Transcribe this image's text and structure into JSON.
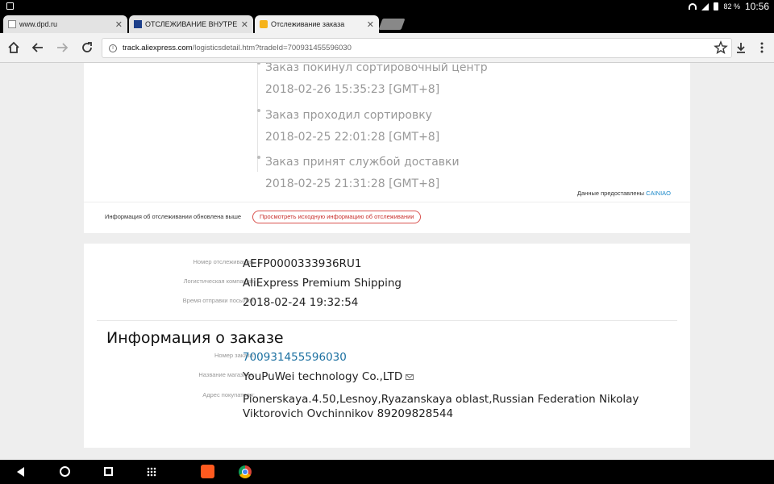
{
  "status_bar": {
    "battery": "82 %",
    "time": "10:56"
  },
  "tabs": [
    {
      "label": "www.dpd.ru",
      "favicon": "page-icon"
    },
    {
      "label": "ОТСЛЕЖИВАНИЕ ВНУТРЕННЕГО",
      "favicon": "tracking-17-icon"
    },
    {
      "label": "Отслеживание заказа",
      "favicon": "aliexpress-icon",
      "active": true
    }
  ],
  "toolbar": {
    "url_host": "track.aliexpress.com",
    "url_path": "/logisticsdetail.htm?tradeId=700931455596030"
  },
  "timeline": [
    {
      "status": "Заказ покинул сортировочный центр",
      "time": "2018-02-26 15:35:23 [GMT+8]"
    },
    {
      "status": "Заказ проходил сортировку",
      "time": "2018-02-25 22:01:28 [GMT+8]"
    },
    {
      "status": "Заказ принят службой доставки",
      "time": "2018-02-25 21:31:28 [GMT+8]"
    }
  ],
  "provided_by": {
    "label": "Данные предоставлены",
    "source": "CAINIAO"
  },
  "update_note": "Информация об отслеживании обновлена выше",
  "original_info_button": "Просмотреть исходную информацию об отслеживании",
  "shipment": {
    "tracking_label": "Номер отслеживания:",
    "tracking_number": "AEFP0000333936RU1",
    "carrier_label": "Логистическая компания:",
    "carrier": "AliExpress Premium Shipping",
    "sent_label": "Время отправки посылки:",
    "sent_time": "2018-02-24 19:32:54"
  },
  "order": {
    "title": "Информация о заказе",
    "order_no_label": "Номер заказа:",
    "order_no": "700931455596030",
    "store_label": "Название магазина:",
    "store": "YouPuWei technology Co.,LTD",
    "address_label": "Адрес покупателя:",
    "address": "Pionerskaya.4.50,Lesnoy,Ryazanskaya oblast,Russian Federation Nikolay Viktorovich Ovchinnikov 89209828544"
  },
  "colors": {
    "link": "#1a6fa0",
    "accent": "#d9534f",
    "cainiao": "#1a88c9"
  }
}
